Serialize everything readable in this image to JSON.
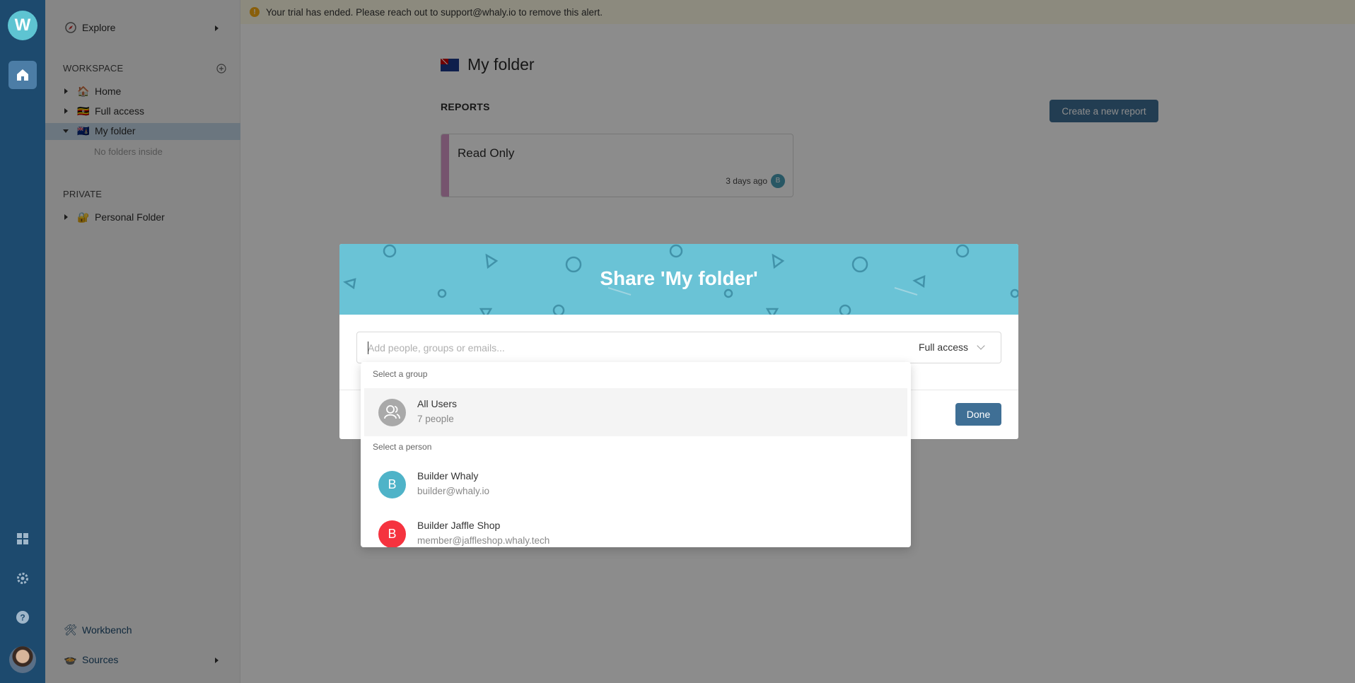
{
  "alert": {
    "text": "Your trial has ended. Please reach out to support@whaly.io to remove this alert."
  },
  "sidebar": {
    "explore_label": "Explore",
    "workspace_label": "WORKSPACE",
    "tree": [
      {
        "label": "Home",
        "emoji": "🏠"
      },
      {
        "label": "Full access",
        "emoji": "🇺🇬"
      },
      {
        "label": "My folder",
        "emoji": "🇰🇾"
      }
    ],
    "no_folders_label": "No folders inside",
    "private_label": "PRIVATE",
    "personal_folder": {
      "label": "Personal Folder",
      "emoji": "🔐"
    },
    "workbench_label": "Workbench",
    "sources_label": "Sources"
  },
  "main": {
    "folder_title": "My folder",
    "reports_label": "REPORTS",
    "create_button": "Create a new report",
    "report": {
      "name": "Read Only",
      "time": "3 days ago",
      "avatar_initial": "B",
      "stripe_color": "#d89ac8"
    }
  },
  "modal": {
    "title": "Share 'My folder'",
    "input_placeholder": "Add people, groups or emails...",
    "input_value": "",
    "access_value": "Full access",
    "done_label": "Done"
  },
  "dropdown": {
    "group_section_label": "Select a group",
    "groups": [
      {
        "name": "All Users",
        "sub": "7 people",
        "icon": "users-icon",
        "color": "#a9a9a9"
      }
    ],
    "person_section_label": "Select a person",
    "people": [
      {
        "name": "Builder Whaly",
        "email": "builder@whaly.io",
        "initial": "B",
        "color": "#4fb3c8"
      },
      {
        "name": "Builder Jaffle Shop",
        "email": "member@jaffleshop.whaly.tech",
        "initial": "B",
        "color": "#f5333f"
      }
    ]
  },
  "colors": {
    "rail": "#1d4a6e",
    "primary_button": "#3f6f95",
    "modal_header": "#6ac3d6",
    "alert_bg": "#fffbe6"
  }
}
